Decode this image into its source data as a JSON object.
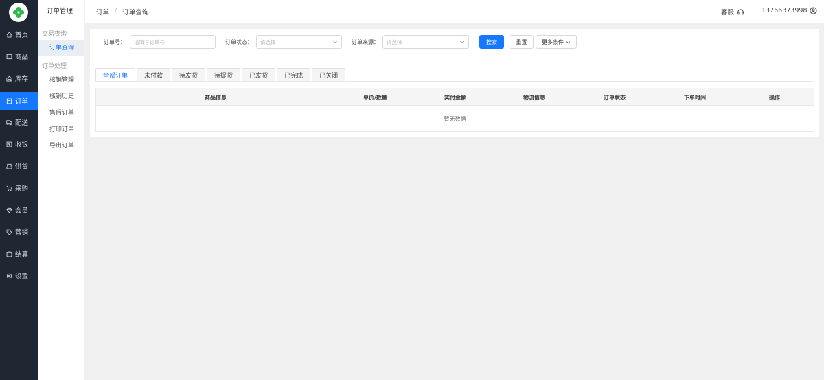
{
  "sidebar": {
    "items": [
      {
        "label": "首页",
        "icon": "home-icon"
      },
      {
        "label": "商品",
        "icon": "product-icon"
      },
      {
        "label": "库存",
        "icon": "warehouse-icon"
      },
      {
        "label": "订单",
        "icon": "order-icon"
      },
      {
        "label": "配送",
        "icon": "truck-icon"
      },
      {
        "label": "收银",
        "icon": "cashier-icon"
      },
      {
        "label": "供货",
        "icon": "supply-icon"
      },
      {
        "label": "采购",
        "icon": "cart-icon"
      },
      {
        "label": "会员",
        "icon": "member-icon"
      },
      {
        "label": "营销",
        "icon": "tag-icon"
      },
      {
        "label": "结算",
        "icon": "settlement-icon"
      },
      {
        "label": "设置",
        "icon": "gear-icon"
      }
    ]
  },
  "submenu": {
    "title": "订单管理",
    "group1": "交易查询",
    "item_query": "订单查询",
    "group2": "订单处理",
    "items": [
      "核销管理",
      "核销历史",
      "售后订单",
      "打印订单",
      "导出订单"
    ]
  },
  "header": {
    "crumb1": "订单",
    "crumb_sep": "/",
    "crumb2": "订单查询",
    "service": "客服",
    "user": "13766373998"
  },
  "filters": {
    "order_no_label": "订单号：",
    "order_no_placeholder": "请填写订单号",
    "status_label": "订单状态：",
    "status_placeholder": "请选择",
    "source_label": "订单来源：",
    "source_placeholder": "请选择",
    "search": "搜索",
    "reset": "重置",
    "more": "更多条件"
  },
  "tabs": [
    "全部订单",
    "未付款",
    "待发货",
    "待提货",
    "已发货",
    "已完成",
    "已关闭"
  ],
  "table": {
    "columns": [
      "商品信息",
      "单价/数量",
      "实付金额",
      "物流信息",
      "订单状态",
      "下单时间",
      "操作"
    ],
    "empty": "暂无数据"
  },
  "colors": {
    "primary": "#1677ff",
    "sidebar": "#1f2733",
    "logo": "#2fb84a"
  }
}
